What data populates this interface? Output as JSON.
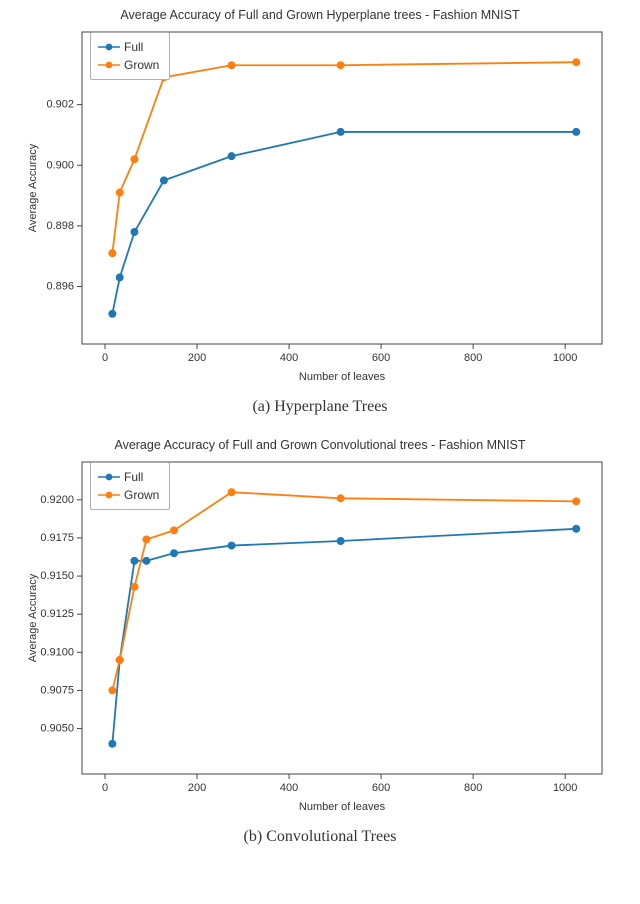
{
  "chart_data": [
    {
      "type": "line",
      "title": "Average Accuracy of Full and Grown Hyperplane trees - Fashion MNIST",
      "xlabel": "Number of leaves",
      "ylabel": "Average Accuracy",
      "x": [
        16,
        32,
        64,
        128,
        275,
        512,
        1024
      ],
      "series": [
        {
          "name": "Full",
          "color": "#1f77b4",
          "values": [
            0.8951,
            0.8963,
            0.8978,
            0.8995,
            0.9003,
            0.9011,
            0.9011
          ]
        },
        {
          "name": "Grown",
          "color": "#ff7f0e",
          "values": [
            0.8971,
            0.8991,
            0.9002,
            0.9029,
            0.9033,
            0.9033,
            0.9034
          ]
        }
      ],
      "xlim": [
        -50,
        1080
      ],
      "yticks": [
        0.896,
        0.898,
        0.9,
        0.902
      ],
      "xticks": [
        0,
        200,
        400,
        600,
        800,
        1000
      ]
    },
    {
      "type": "line",
      "title": "Average Accuracy of Full and Grown Convolutional trees - Fashion MNIST",
      "xlabel": "Number of leaves",
      "ylabel": "Average Accuracy",
      "x": [
        16,
        32,
        64,
        90,
        150,
        275,
        512,
        1024
      ],
      "series": [
        {
          "name": "Full",
          "color": "#1f77b4",
          "values": [
            0.904,
            0.9095,
            0.916,
            0.916,
            0.9165,
            0.917,
            0.9173,
            0.9181
          ]
        },
        {
          "name": "Grown",
          "color": "#ff7f0e",
          "values": [
            0.9075,
            0.9095,
            0.9143,
            0.9174,
            0.918,
            0.9205,
            0.9201,
            0.9199
          ]
        }
      ],
      "xlim": [
        -50,
        1080
      ],
      "yticks": [
        0.905,
        0.9075,
        0.91,
        0.9125,
        0.915,
        0.9175,
        0.92
      ],
      "xticks": [
        0,
        200,
        400,
        600,
        800,
        1000
      ]
    }
  ],
  "captions": {
    "a": "(a) Hyperplane Trees",
    "b": "(b) Convolutional Trees"
  },
  "legend": {
    "full": "Full",
    "grown": "Grown"
  }
}
